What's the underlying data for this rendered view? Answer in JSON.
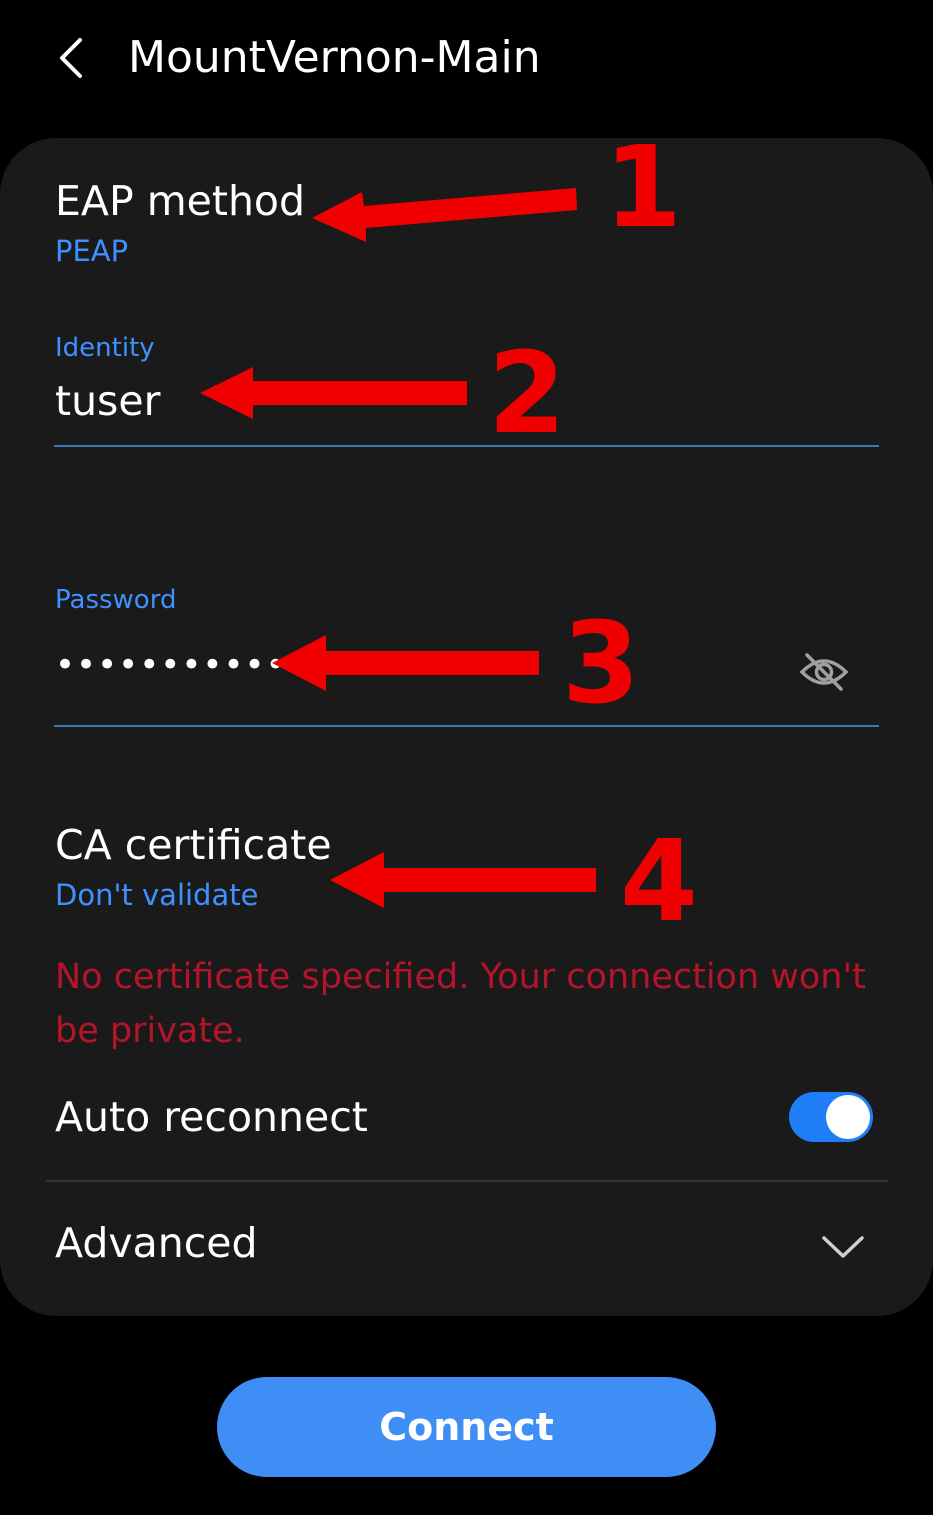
{
  "header": {
    "back_icon": "chevron-left-icon",
    "title": "MountVernon-Main"
  },
  "eap_method": {
    "title": "EAP method",
    "value": "PEAP"
  },
  "identity": {
    "label": "Identity",
    "value": "tuser"
  },
  "password": {
    "label": "Password",
    "masked_value": "••••••••••••",
    "visibility_icon": "eye-slash-icon"
  },
  "ca_certificate": {
    "title": "CA certificate",
    "value": "Don't validate",
    "warning": "No certificate specified. Your connection won't be private."
  },
  "auto_reconnect": {
    "label": "Auto reconnect",
    "enabled": true
  },
  "advanced": {
    "label": "Advanced",
    "icon": "chevron-down-icon"
  },
  "connect_button": {
    "label": "Connect"
  },
  "annotations": {
    "color": "#f00000",
    "callouts": [
      "1",
      "2",
      "3",
      "4"
    ]
  },
  "colors": {
    "accent": "#3e91ff",
    "warning": "#b3152a",
    "toggle_on": "#1f7ef7",
    "button": "#3f8ef5"
  }
}
